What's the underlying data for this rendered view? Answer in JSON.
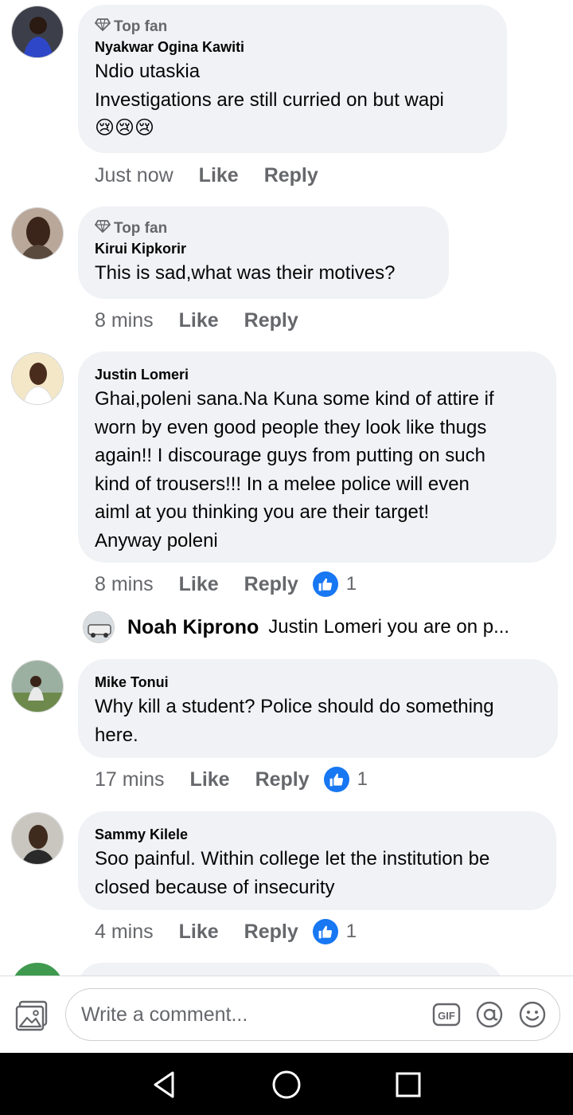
{
  "comments": [
    {
      "name": "Nyakwar Ogina Kawiti",
      "badge": "Top fan",
      "lines": [
        "Ndio utaskia",
        "Investigations are still curried on but wapi",
        "😢😢😢"
      ],
      "time": "Just now",
      "like_label": "Like",
      "reply_label": "Reply"
    },
    {
      "name": "Kirui Kipkorir",
      "badge": "Top fan",
      "lines": [
        "This is sad,what was their motives?"
      ],
      "time": "8 mins",
      "like_label": "Like",
      "reply_label": "Reply"
    },
    {
      "name": "Justin Lomeri",
      "lines": [
        "Ghai,poleni sana.Na Kuna some kind of attire if",
        "worn by even good people they look like thugs",
        "again!! I discourage guys from putting on such",
        "kind of trousers!!! In a melee police will even",
        "aiml at you thinking you are their target!",
        "Anyway poleni"
      ],
      "time": "8 mins",
      "like_label": "Like",
      "reply_label": "Reply",
      "reactions": "1",
      "reply_preview": {
        "name": "Noah Kiprono",
        "text": "Justin Lomeri you are on p..."
      }
    },
    {
      "name": "Mike Tonui",
      "lines": [
        "Why kill a student? Police should do something",
        "here."
      ],
      "time": "17 mins",
      "like_label": "Like",
      "reply_label": "Reply",
      "reactions": "1"
    },
    {
      "name": "Sammy Kilele",
      "lines": [
        "Soo painful. Within college let the institution be",
        "closed because of insecurity"
      ],
      "time": "4 mins",
      "like_label": "Like",
      "reply_label": "Reply",
      "reactions": "1"
    }
  ],
  "composer": {
    "placeholder": "Write a comment..."
  },
  "icons": {
    "badge": "diamond-icon",
    "reaction": "thumbs-up-icon",
    "photo": "photo-icon",
    "gif": "gif-icon",
    "mention": "at-sign-icon",
    "emoji": "smiley-icon",
    "nav_back": "back-triangle-icon",
    "nav_home": "home-circle-icon",
    "nav_recent": "recent-square-icon"
  },
  "colors": {
    "accent": "#1877f2",
    "bubble": "#f0f2f5",
    "meta": "#65676b"
  }
}
